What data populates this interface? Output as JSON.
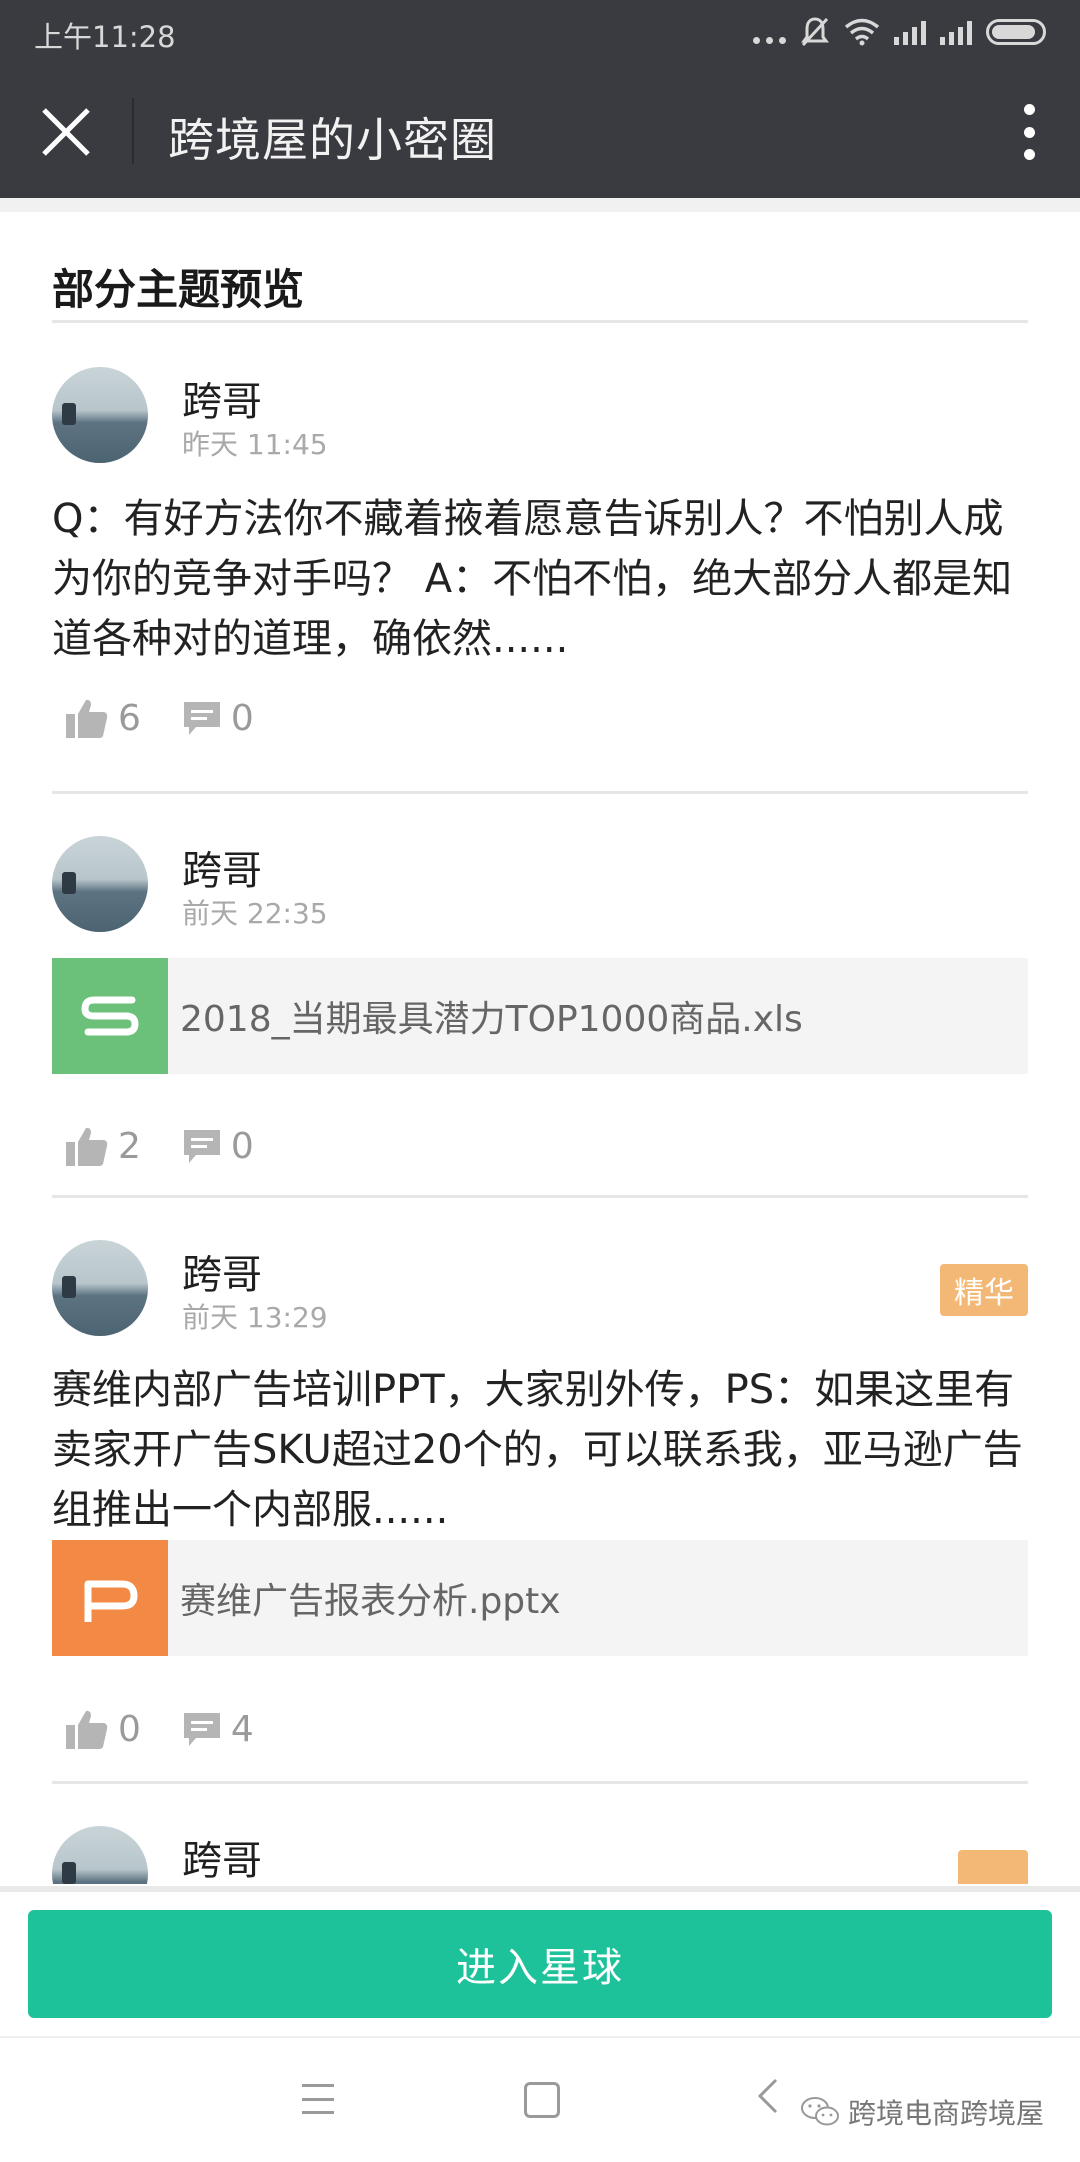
{
  "status_bar": {
    "time": "上午11:28"
  },
  "header": {
    "title": "跨境屋的小密圈"
  },
  "section": {
    "title": "部分主题预览"
  },
  "posts": [
    {
      "author": "跨哥",
      "time": "昨天 11:45",
      "text": "Q：有好方法你不藏着掖着愿意告诉别人？不怕别人成为你的竞争对手吗？ A：不怕不怕，绝大部分人都是知道各种对的道理，确依然......",
      "likes": "6",
      "comments": "0"
    },
    {
      "author": "跨哥",
      "time": "前天 22:35",
      "file": {
        "name": "2018_当期最具潜力TOP1000商品.xls",
        "type": "spreadsheet",
        "color": "#6cc17a"
      },
      "likes": "2",
      "comments": "0"
    },
    {
      "author": "跨哥",
      "time": "前天 13:29",
      "badge": "精华",
      "text": "赛维内部广告培训PPT，大家别外传，PS：如果这里有卖家开广告SKU超过20个的，可以联系我，亚马逊广告组推出一个内部服......",
      "file": {
        "name": "赛维广告报表分析.pptx",
        "type": "presentation",
        "color": "#f28a45"
      },
      "likes": "0",
      "comments": "4"
    },
    {
      "author": "跨哥"
    }
  ],
  "enter_button": {
    "label": "进入星球"
  },
  "watermark": {
    "label": "跨境电商跨境屋"
  },
  "colors": {
    "accent": "#1ec29a",
    "badge": "#f4b876",
    "bar": "#3a3b40"
  }
}
